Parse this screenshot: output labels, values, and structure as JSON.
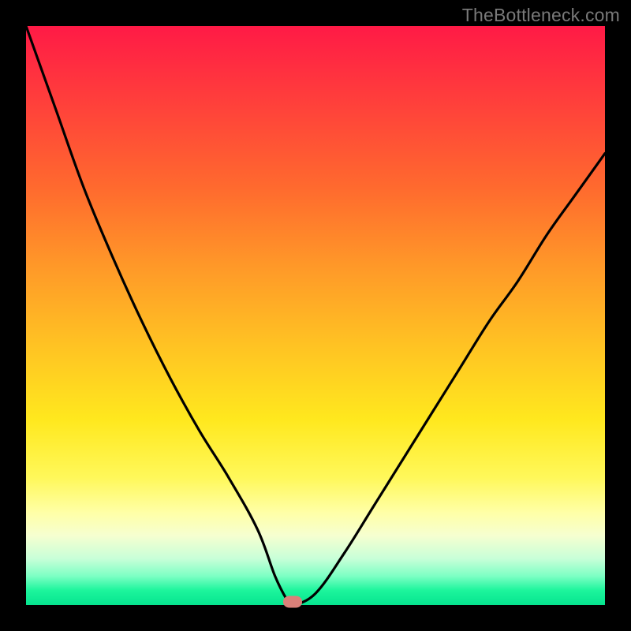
{
  "attribution": "TheBottleneck.com",
  "chart_data": {
    "type": "line",
    "title": "",
    "xlabel": "",
    "ylabel": "",
    "xlim": [
      0,
      100
    ],
    "ylim": [
      0,
      100
    ],
    "series": [
      {
        "name": "bottleneck-curve",
        "x": [
          0,
          5,
          10,
          15,
          20,
          25,
          30,
          35,
          40,
          43,
          45,
          46,
          50,
          55,
          60,
          65,
          70,
          75,
          80,
          85,
          90,
          95,
          100
        ],
        "values": [
          100,
          86,
          72,
          60,
          49,
          39,
          30,
          22,
          13,
          5,
          1,
          0,
          2,
          9,
          17,
          25,
          33,
          41,
          49,
          56,
          64,
          71,
          78
        ]
      }
    ],
    "marker": {
      "x": 46,
      "y": 0.5
    },
    "background": "rainbow-vertical",
    "colors": {
      "top": "#ff1a46",
      "mid": "#ffe81e",
      "bottom": "#06e48f",
      "curve": "#000000",
      "marker": "#da8079"
    }
  }
}
